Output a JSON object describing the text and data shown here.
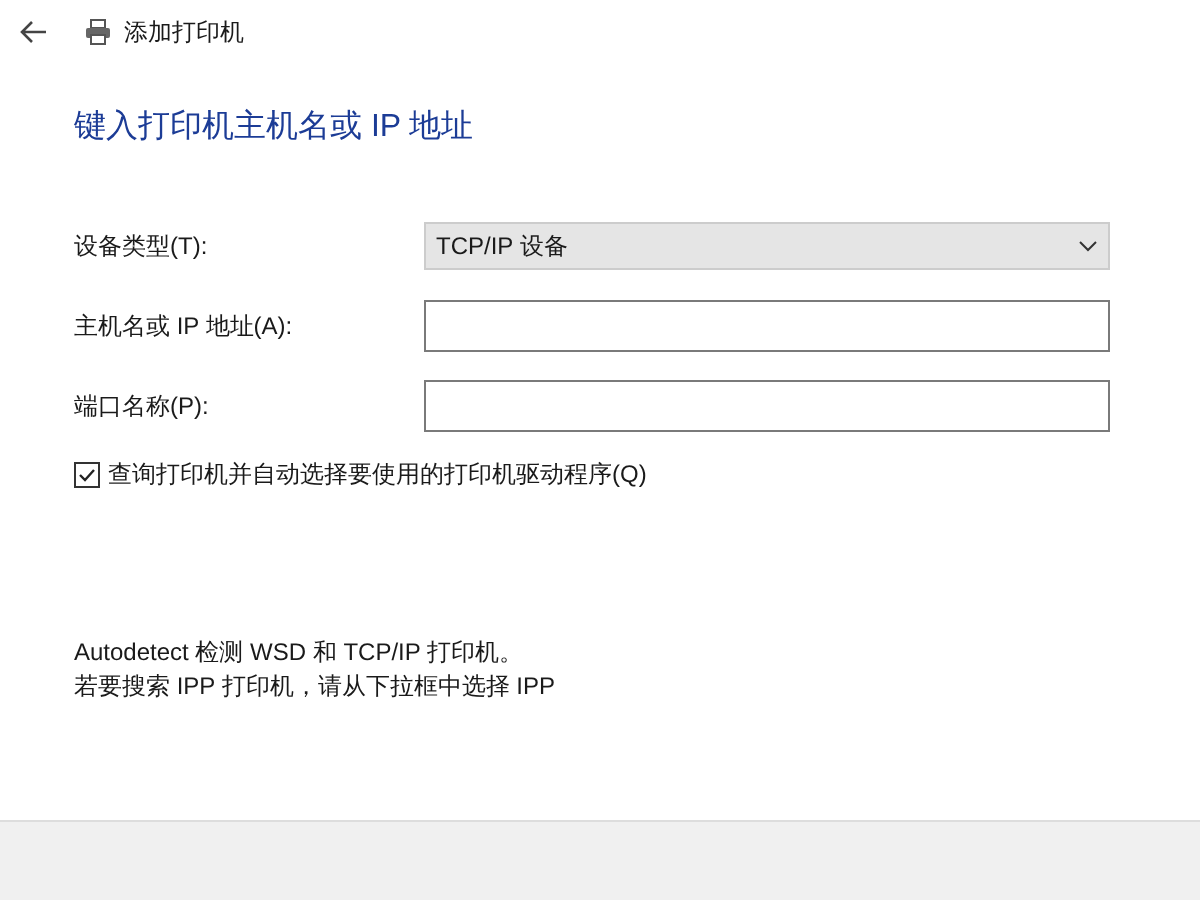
{
  "window": {
    "title": "添加打印机"
  },
  "heading": "键入打印机主机名或 IP 地址",
  "fields": [
    {
      "kind": "dropdown",
      "label": "设备类型(T):",
      "value": "TCP/IP 设备"
    },
    {
      "kind": "text",
      "label": "主机名或 IP 地址(A):"
    },
    {
      "kind": "text",
      "label": "端口名称(P):"
    }
  ],
  "checkbox": {
    "label": "查询打印机并自动选择要使用的打印机驱动程序(Q)",
    "checked": true
  },
  "info": [
    "Autodetect 检测 WSD 和 TCP/IP 打印机。",
    "若要搜索 IPP 打印机，请从下拉框中选择 IPP"
  ]
}
